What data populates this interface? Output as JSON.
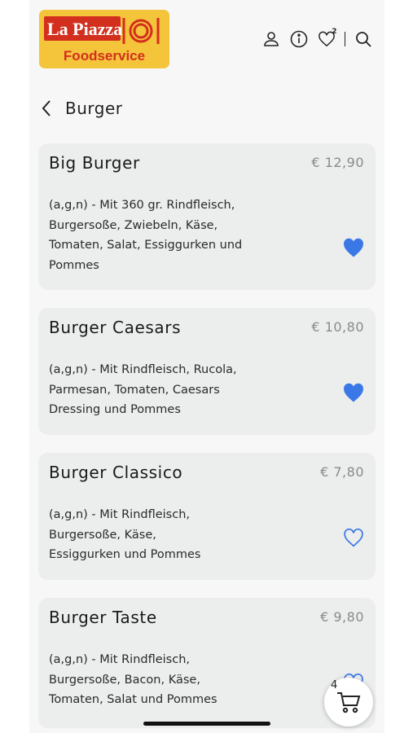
{
  "brand": {
    "name": "La Piazza",
    "tagline": "Foodservice"
  },
  "header": {
    "icons": [
      "user-icon",
      "info-icon",
      "heart-icon",
      "search-icon"
    ],
    "favorites_count": "2"
  },
  "page": {
    "title": "Burger"
  },
  "products": [
    {
      "name": "Big Burger",
      "price": "€ 12,90",
      "desc_lines": [
        "(a,g,n) - Mit 360 gr. Rindfleisch,",
        "Burgersoße, Zwiebeln, Käse,",
        "Tomaten, Salat, Essiggurken und",
        "Pommes"
      ],
      "favorite": true
    },
    {
      "name": "Burger Caesars",
      "price": "€ 10,80",
      "desc_lines": [
        "(a,g,n) - Mit Rindfleisch, Rucola,",
        "Parmesan, Tomaten, Caesars",
        "Dressing und Pommes"
      ],
      "favorite": true
    },
    {
      "name": "Burger Classico",
      "price": "€ 7,80",
      "desc_lines": [
        "(a,g,n) - Mit Rindfleisch,",
        "Burgersoße, Käse,",
        "Essiggurken und Pommes"
      ],
      "favorite": false
    },
    {
      "name": "Burger Taste",
      "price": "€ 9,80",
      "desc_lines": [
        "(a,g,n) - Mit Rindfleisch,",
        "Burgersoße, Bacon, Käse,",
        "Tomaten, Salat und Pommes"
      ],
      "favorite": false
    }
  ],
  "cart": {
    "count": "4"
  },
  "colors": {
    "accent": "#3b78e7",
    "card_bg": "#eceded",
    "logo_bg": "#f4c53a",
    "logo_red": "#d32f1e"
  }
}
